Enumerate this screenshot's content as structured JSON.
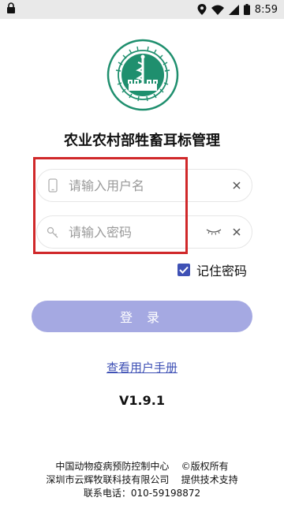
{
  "status_bar": {
    "time": "8:59"
  },
  "logo": {
    "ring_text": "中国动物疫病预防控制中心",
    "ring_text_en": "China Animal Disease Control Center"
  },
  "app_title": "农业农村部牲畜耳标管理",
  "username_field": {
    "placeholder": "请输入用户名",
    "value": ""
  },
  "password_field": {
    "placeholder": "请输入密码",
    "value": ""
  },
  "remember": {
    "label": "记住密码",
    "checked": true
  },
  "login_button": {
    "label": "登录"
  },
  "manual_link": "查看用户手册",
  "version": "V1.9.1",
  "footer": {
    "line1": "中国动物疫病预防控制中心    ©版权所有",
    "line2": "深圳市云辉牧联科技有限公司    提供技术支持",
    "line3": "联系电话：010-59198872"
  },
  "colors": {
    "accent": "#3f51b5",
    "button_bg": "#a5a9e2",
    "highlight": "#d0282a",
    "logo_green": "#1f8f6e"
  }
}
